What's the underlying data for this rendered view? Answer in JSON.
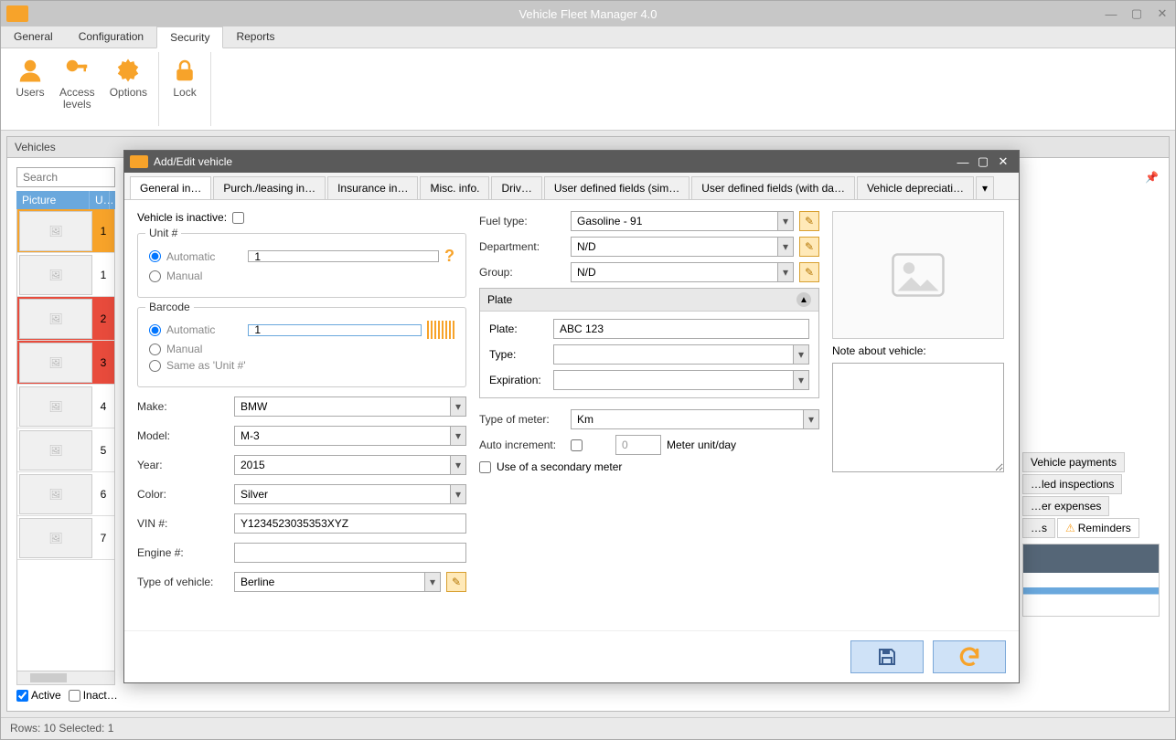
{
  "app": {
    "title": "Vehicle Fleet Manager 4.0"
  },
  "menu": {
    "tabs": [
      "General",
      "Configuration",
      "Security",
      "Reports"
    ],
    "active": 2
  },
  "ribbon": {
    "buttons": [
      {
        "label": "Users"
      },
      {
        "label": "Access\nlevels"
      },
      {
        "label": "Options"
      },
      {
        "label": "Lock"
      }
    ]
  },
  "vehicles_panel": {
    "title": "Vehicles",
    "search_placeholder": "Search",
    "columns": [
      "Picture",
      "U…"
    ],
    "rows": [
      {
        "unit": "1",
        "state": "sel"
      },
      {
        "unit": "1",
        "state": ""
      },
      {
        "unit": "2",
        "state": "red"
      },
      {
        "unit": "3",
        "state": "red"
      },
      {
        "unit": "4",
        "state": ""
      },
      {
        "unit": "5",
        "state": ""
      },
      {
        "unit": "6",
        "state": ""
      },
      {
        "unit": "7",
        "state": ""
      }
    ],
    "filters": {
      "active_label": "Active",
      "active_checked": true,
      "inactive_label": "Inact…",
      "inactive_checked": false
    }
  },
  "right_tabs": {
    "row1": [
      "Vehicle payments"
    ],
    "row2": [
      "…led inspections"
    ],
    "row3": [
      "…er expenses"
    ],
    "row4": [
      "…s",
      "Reminders"
    ]
  },
  "status": {
    "text": "Rows: 10  Selected: 1"
  },
  "dialog": {
    "title": "Add/Edit vehicle",
    "tabs": [
      "General in…",
      "Purch./leasing in…",
      "Insurance in…",
      "Misc. info.",
      "Driv…",
      "User defined fields (sim…",
      "User defined fields (with da…",
      "Vehicle depreciati…"
    ],
    "active_tab": 0,
    "inactive_label": "Vehicle is inactive:",
    "inactive_checked": false,
    "unit": {
      "title": "Unit #",
      "auto_label": "Automatic",
      "manual_label": "Manual",
      "selected": "auto",
      "value": "1"
    },
    "barcode": {
      "title": "Barcode",
      "auto_label": "Automatic",
      "manual_label": "Manual",
      "same_label": "Same as 'Unit #'",
      "selected": "auto",
      "value": "1"
    },
    "left_fields": {
      "make_label": "Make:",
      "make_value": "BMW",
      "model_label": "Model:",
      "model_value": "M-3",
      "year_label": "Year:",
      "year_value": "2015",
      "color_label": "Color:",
      "color_value": "Silver",
      "vin_label": "VIN #:",
      "vin_value": "Y1234523035353XYZ",
      "engine_label": "Engine #:",
      "engine_value": "",
      "type_label": "Type of vehicle:",
      "type_value": "Berline"
    },
    "mid_fields": {
      "fuel_label": "Fuel type:",
      "fuel_value": "Gasoline - 91",
      "dept_label": "Department:",
      "dept_value": "N/D",
      "group_label": "Group:",
      "group_value": "N/D",
      "plate_title": "Plate",
      "plate_label": "Plate:",
      "plate_value": "ABC 123",
      "ptype_label": "Type:",
      "ptype_value": "",
      "exp_label": "Expiration:",
      "exp_value": "",
      "meter_label": "Type of meter:",
      "meter_value": "Km",
      "autoinc_label": "Auto increment:",
      "autoinc_checked": false,
      "meterunit_value": "0",
      "meterunit_label": "Meter unit/day",
      "secondary_label": "Use of a secondary meter",
      "secondary_checked": false
    },
    "right": {
      "note_label": "Note about vehicle:"
    }
  }
}
